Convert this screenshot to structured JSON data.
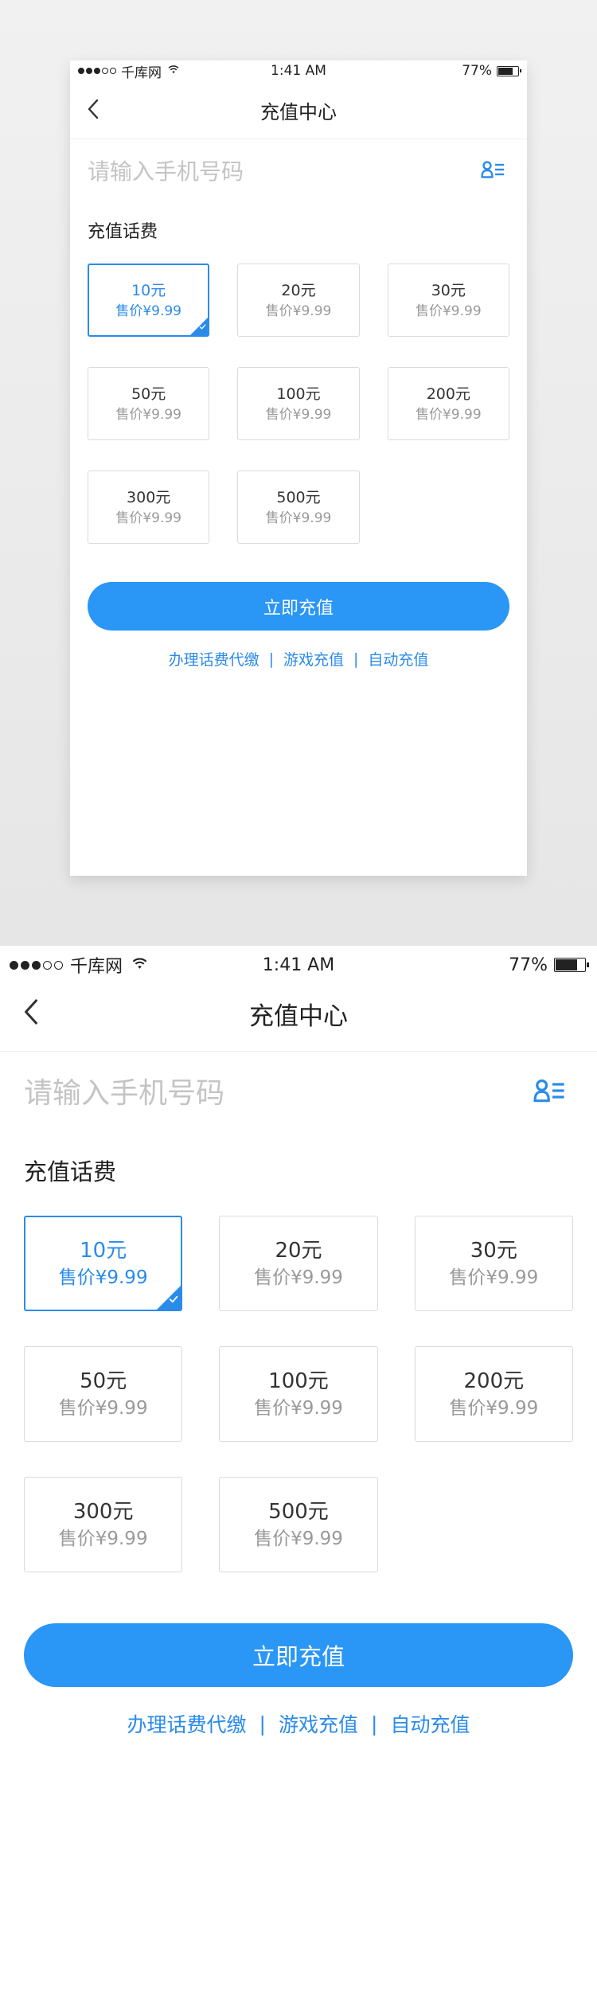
{
  "status_bar": {
    "carrier": "千库网",
    "time": "1:41 AM",
    "battery": "77%",
    "battery_level": 0.77
  },
  "nav": {
    "title": "充值中心"
  },
  "phone": {
    "placeholder": "请输入手机号码"
  },
  "section_title": "充值话费",
  "options": [
    {
      "amount": "10元",
      "price": "售价¥9.99",
      "selected": true
    },
    {
      "amount": "20元",
      "price": "售价¥9.99",
      "selected": false
    },
    {
      "amount": "30元",
      "price": "售价¥9.99",
      "selected": false
    },
    {
      "amount": "50元",
      "price": "售价¥9.99",
      "selected": false
    },
    {
      "amount": "100元",
      "price": "售价¥9.99",
      "selected": false
    },
    {
      "amount": "200元",
      "price": "售价¥9.99",
      "selected": false
    },
    {
      "amount": "300元",
      "price": "售价¥9.99",
      "selected": false
    },
    {
      "amount": "500元",
      "price": "售价¥9.99",
      "selected": false
    }
  ],
  "submit_label": "立即充值",
  "links": [
    "办理话费代缴",
    "游戏充值",
    "自动充值"
  ],
  "link_separator": "|",
  "colors": {
    "accent": "#2b8be9",
    "button": "#2a96f5",
    "border": "#dadada",
    "placeholder": "#c4c4c4"
  },
  "icons": {
    "back": "chevron-left-icon",
    "contacts": "contacts-icon",
    "wifi": "wifi-icon",
    "check": "check-icon"
  }
}
